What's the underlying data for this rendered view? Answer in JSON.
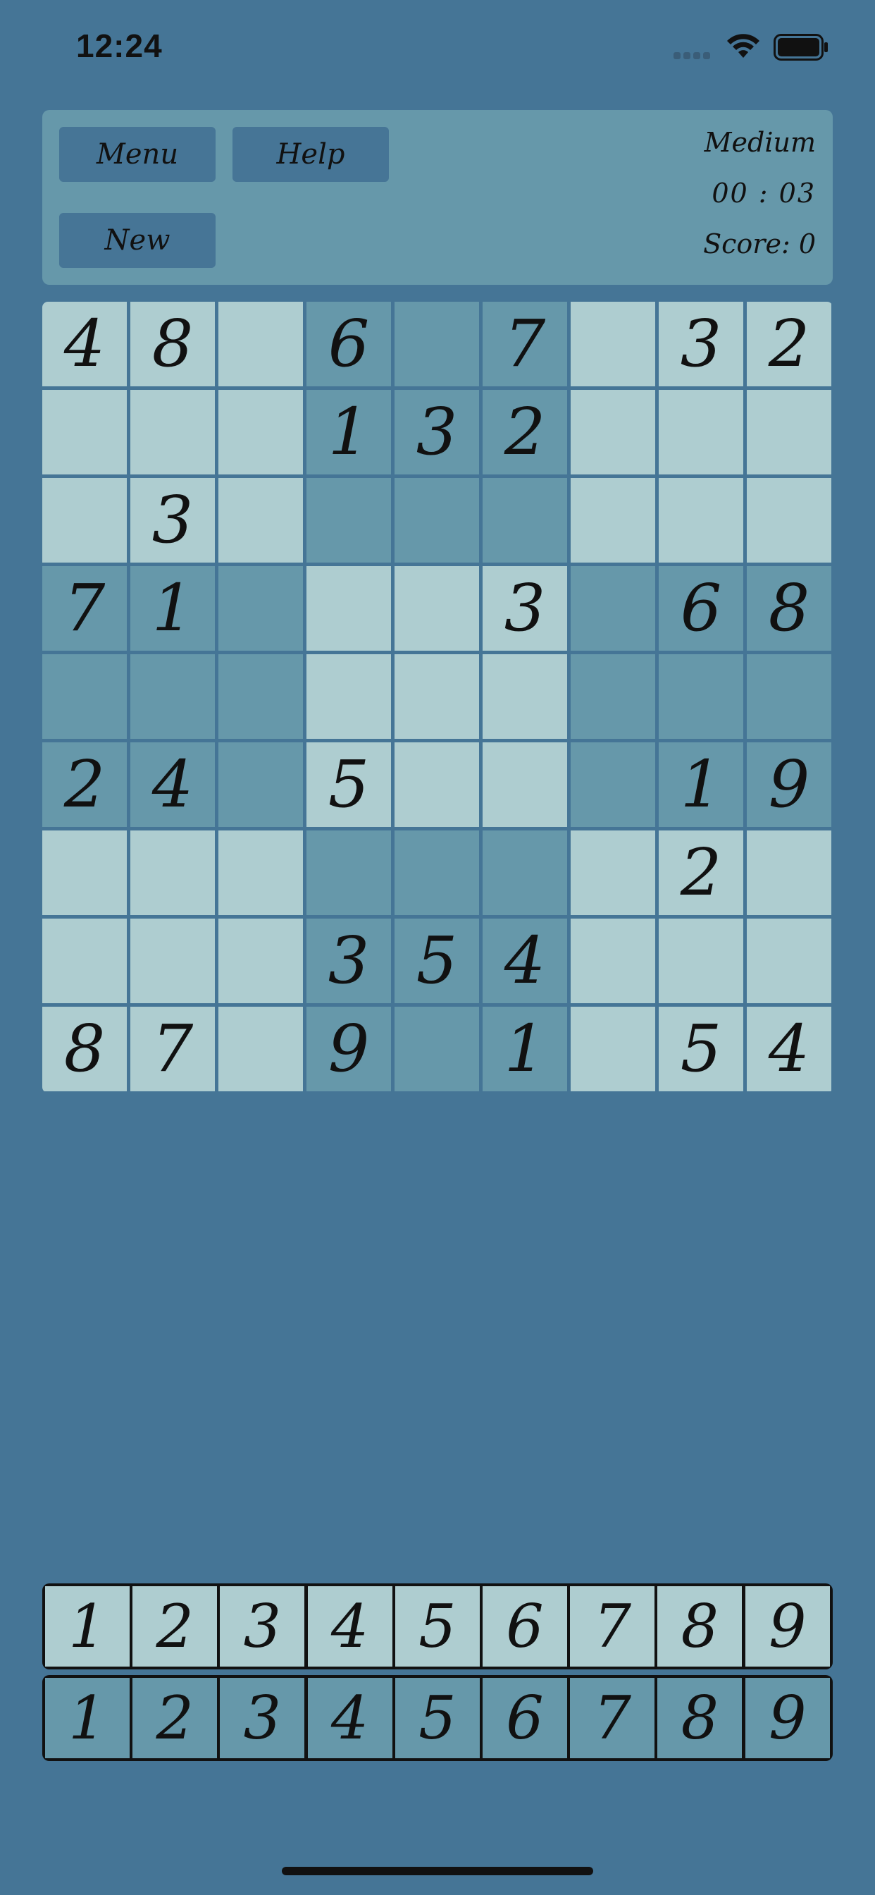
{
  "status_bar": {
    "time": "12:24"
  },
  "header": {
    "menu_label": "Menu",
    "help_label": "Help",
    "new_label": "New",
    "difficulty": "Medium",
    "timer": "00 : 03",
    "score": "Score: 0"
  },
  "board": [
    [
      "4",
      "8",
      "",
      "6",
      "",
      "7",
      "",
      "3",
      "2"
    ],
    [
      "",
      "",
      "",
      "1",
      "3",
      "2",
      "",
      "",
      ""
    ],
    [
      "",
      "3",
      "",
      "",
      "",
      "",
      "",
      "",
      ""
    ],
    [
      "7",
      "1",
      "",
      "",
      "",
      "3",
      "",
      "6",
      "8"
    ],
    [
      "",
      "",
      "",
      "",
      "",
      "",
      "",
      "",
      ""
    ],
    [
      "2",
      "4",
      "",
      "5",
      "",
      "",
      "",
      "1",
      "9"
    ],
    [
      "",
      "",
      "",
      "",
      "",
      "",
      "",
      "2",
      ""
    ],
    [
      "",
      "",
      "",
      "3",
      "5",
      "4",
      "",
      "",
      ""
    ],
    [
      "8",
      "7",
      "",
      "9",
      "",
      "1",
      "",
      "5",
      "4"
    ]
  ],
  "number_pad": {
    "row1": [
      "1",
      "2",
      "3",
      "4",
      "5",
      "6",
      "7",
      "8",
      "9"
    ],
    "row2": [
      "1",
      "2",
      "3",
      "4",
      "5",
      "6",
      "7",
      "8",
      "9"
    ]
  },
  "colors": {
    "background": "#457596",
    "panel": "#6698aa",
    "cell_light": "#aecdd0",
    "cell_dark": "#6698aa",
    "button": "#467596"
  }
}
